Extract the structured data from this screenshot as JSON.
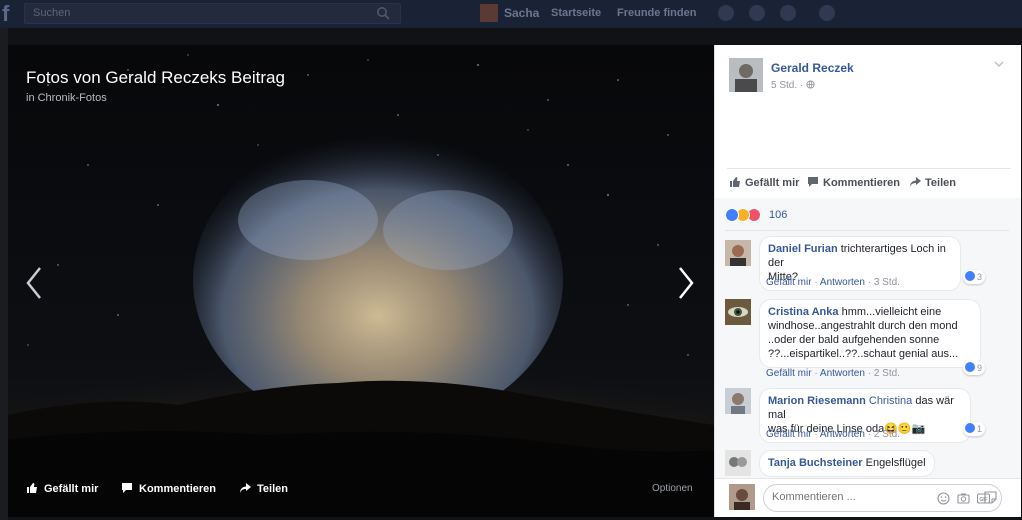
{
  "topbar": {
    "logo": "f",
    "search_placeholder": "Suchen",
    "user_name": "Sacha",
    "nav_home": "Startseite",
    "nav_find_friends": "Freunde finden"
  },
  "photo": {
    "title": "Fotos von Gerald Reczeks Beitrag",
    "album": "in Chronik-Fotos",
    "like_label": "Gefällt mir",
    "comment_label": "Kommentieren",
    "share_label": "Teilen",
    "options_label": "Optionen"
  },
  "post": {
    "author": "Gerald Reczek",
    "time": "5 Std.",
    "privacy_icon": "globe-icon",
    "actions": {
      "like": "Gefällt mir",
      "comment": "Kommentieren",
      "share": "Teilen"
    },
    "reaction_count": "106"
  },
  "comments": [
    {
      "author": "Daniel Furian",
      "lines": [
        "trichterartiges Loch in der",
        "Mitte?"
      ],
      "like": "Gefällt mir",
      "reply": "Antworten",
      "time": "3 Std.",
      "likes": "3"
    },
    {
      "author": "Cristina Anka",
      "lines": [
        "hmm...vielleicht eine",
        "windhose..angestrahlt durch den mond",
        "..oder der bald aufgehenden sonne",
        "??...eispartikel..??..schaut genial aus..."
      ],
      "like": "Gefällt mir",
      "reply": "Antworten",
      "time": "2 Std.",
      "likes": "9"
    },
    {
      "author": "Marion Riesemann",
      "mention": "Christina",
      "lines": [
        "das wär mal",
        "was für deine Linse oda😆🙂📷"
      ],
      "like": "Gefällt mir",
      "reply": "Antworten",
      "time": "2 Std.",
      "likes": "1"
    },
    {
      "author": "Tanja Buchsteiner",
      "lines": [
        "Engelsflügel"
      ]
    }
  ],
  "comment_input": {
    "placeholder": "Kommentieren ..."
  },
  "colors": {
    "link": "#365899",
    "like_blue": "#4080ff",
    "love_red": "#f25268",
    "wow_yellow": "#f7b125"
  }
}
